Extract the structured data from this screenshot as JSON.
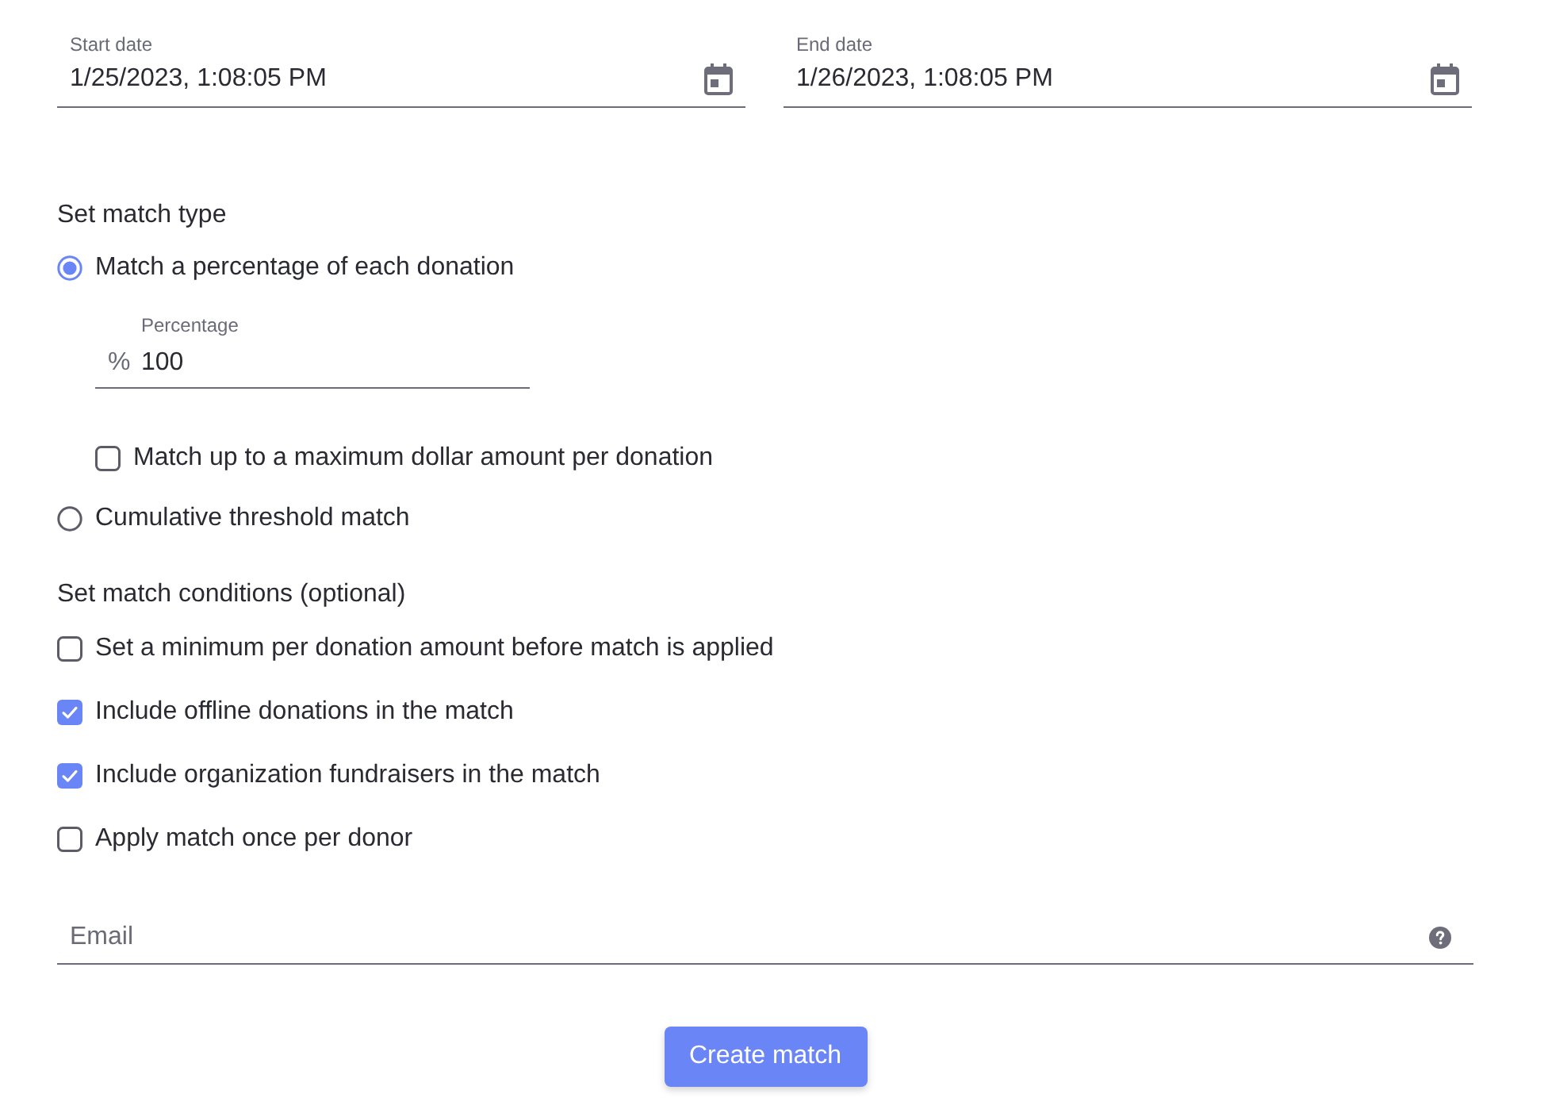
{
  "date_fields": [
    {
      "label": "Start date",
      "value": "1/25/2023, 1:08:05 PM"
    },
    {
      "label": "End date",
      "value": "1/26/2023, 1:08:05 PM"
    }
  ],
  "match_type": {
    "heading": "Set match type",
    "options": [
      {
        "label": "Match a percentage of each donation",
        "selected": true,
        "percentage_field": {
          "label": "Percentage",
          "prefix": "%",
          "value": "100"
        },
        "cap_option": {
          "label": "Match up to a maximum dollar amount per donation",
          "checked": false
        }
      },
      {
        "label": "Cumulative threshold match",
        "selected": false
      }
    ]
  },
  "match_conditions": {
    "heading": "Set match conditions (optional)",
    "items": [
      {
        "label": "Set a minimum per donation amount before match is applied",
        "checked": false
      },
      {
        "label": "Include offline donations in the match",
        "checked": true
      },
      {
        "label": "Include organization fundraisers in the match",
        "checked": true
      },
      {
        "label": "Apply match once per donor",
        "checked": false
      }
    ]
  },
  "email_field": {
    "placeholder": "Email"
  },
  "submit_button": {
    "label": "Create match"
  }
}
